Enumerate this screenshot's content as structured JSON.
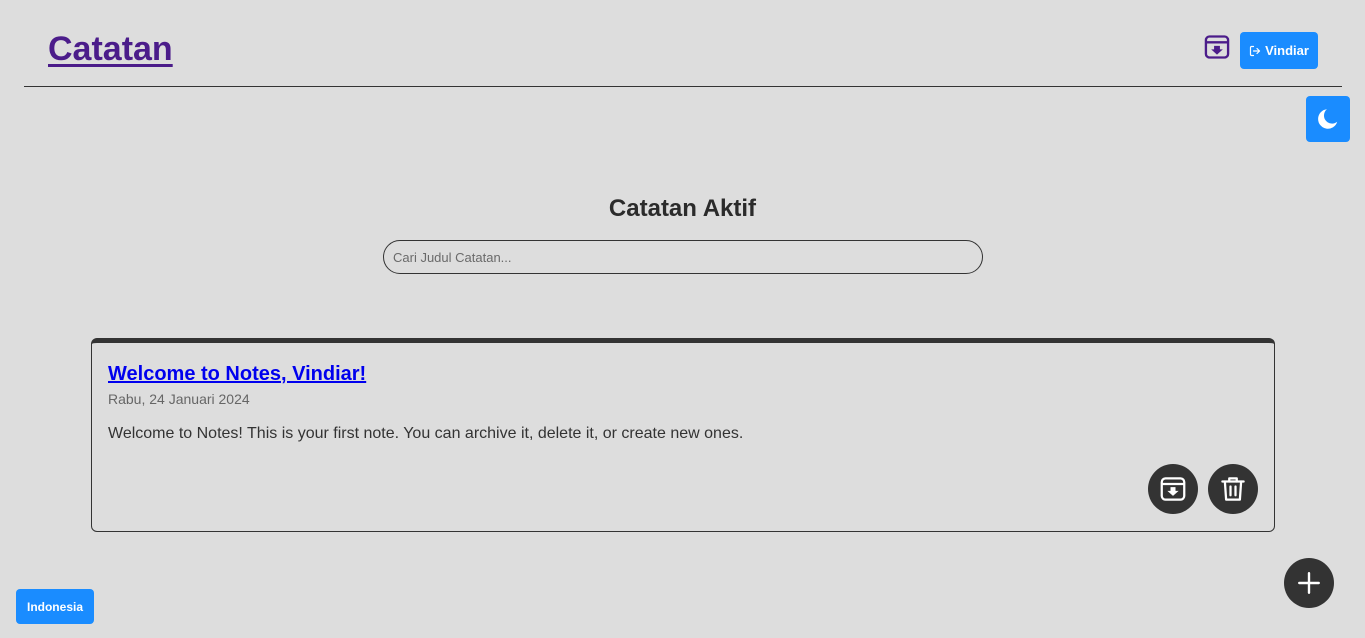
{
  "header": {
    "title": "Catatan",
    "archive_icon": "archive-icon",
    "logout_label": "Vindiar",
    "logout_icon": "logout-icon",
    "accent_color": "#1a8cff",
    "title_color": "#4b1c8a"
  },
  "theme_toggle": {
    "icon": "moon-icon"
  },
  "main": {
    "heading": "Catatan Aktif",
    "search": {
      "placeholder": "Cari Judul Catatan...",
      "value": ""
    }
  },
  "notes": [
    {
      "title": "Welcome to Notes, Vindiar!",
      "date": "Rabu, 24 Januari 2024",
      "body": "Welcome to Notes! This is your first note. You can archive it, delete it, or create new ones.",
      "actions": [
        "archive-icon",
        "trash-icon"
      ]
    }
  ],
  "fab": {
    "icon": "plus-icon"
  },
  "language_toggle": {
    "label": "Indonesia"
  }
}
